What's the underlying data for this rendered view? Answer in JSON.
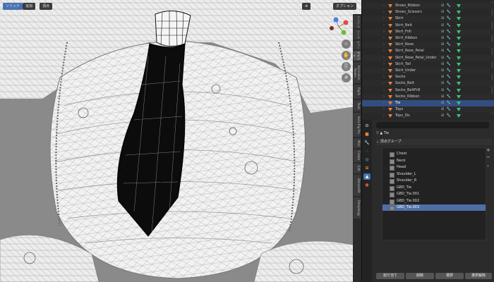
{
  "viewport": {
    "header_buttons": [
      "ソリッド",
      "追加",
      "頂点"
    ],
    "option_label": "オプション",
    "nav_icons": [
      "zoom-icon",
      "hand-icon",
      "camera-icon",
      "grid-icon"
    ],
    "gizmo_axes": [
      "X",
      "Y",
      "Z"
    ],
    "n_tabs": [
      "アイテム",
      "ツール",
      "ビュー",
      "ペイント",
      "Animation Nodes",
      "Rigify",
      "Tools",
      "Auto-Rig Pro",
      "Misc",
      "Create",
      "Edit",
      "BlenderKit",
      "Retopology"
    ]
  },
  "outliner": {
    "items": [
      {
        "label": "Shoes_Ribbon",
        "selected": false
      },
      {
        "label": "Shoes_Scissors",
        "selected": false
      },
      {
        "label": "Skirt",
        "selected": false
      },
      {
        "label": "Skirt_Belt",
        "selected": false
      },
      {
        "label": "Skirt_Frill",
        "selected": false
      },
      {
        "label": "Skirt_Ribbon",
        "selected": false
      },
      {
        "label": "Skirt_Rose",
        "selected": false
      },
      {
        "label": "Skirt_Rose_Petal",
        "selected": false
      },
      {
        "label": "Skirt_Rose_Petal_Under",
        "selected": false
      },
      {
        "label": "Skirt_Tail",
        "selected": false
      },
      {
        "label": "Skirt_Under",
        "selected": false
      },
      {
        "label": "Socks",
        "selected": false
      },
      {
        "label": "Socks_Belt",
        "selected": false
      },
      {
        "label": "Socks_BeltFrill",
        "selected": false
      },
      {
        "label": "Socks_Ribbon",
        "selected": false
      },
      {
        "label": "Tie",
        "selected": true
      },
      {
        "label": "Tops",
        "selected": false
      },
      {
        "label": "Tops_Sls",
        "selected": false
      }
    ]
  },
  "properties": {
    "object_name": "Tie",
    "panel_title": "頂点グループ",
    "vertex_groups": [
      {
        "label": "Chest",
        "selected": false
      },
      {
        "label": "Neck",
        "selected": false
      },
      {
        "label": "Head",
        "selected": false
      },
      {
        "label": "Shoulder_L",
        "selected": false
      },
      {
        "label": "Shoulder_R",
        "selected": false
      },
      {
        "label": "GBD_Tie",
        "selected": false
      },
      {
        "label": "GBD_Tie.001",
        "selected": false
      },
      {
        "label": "GBD_Tie.002",
        "selected": false
      },
      {
        "label": "GBD_Tie.003",
        "selected": true
      }
    ],
    "assign_label": "割り当て",
    "remove_label": "削除",
    "select_label": "選択",
    "deselect_label": "選択解除"
  },
  "colors": {
    "accent": "#4772b3",
    "selection": "#334d80",
    "mesh_tri": "#e3833c",
    "vgroup_tri": "#3fc07a"
  }
}
